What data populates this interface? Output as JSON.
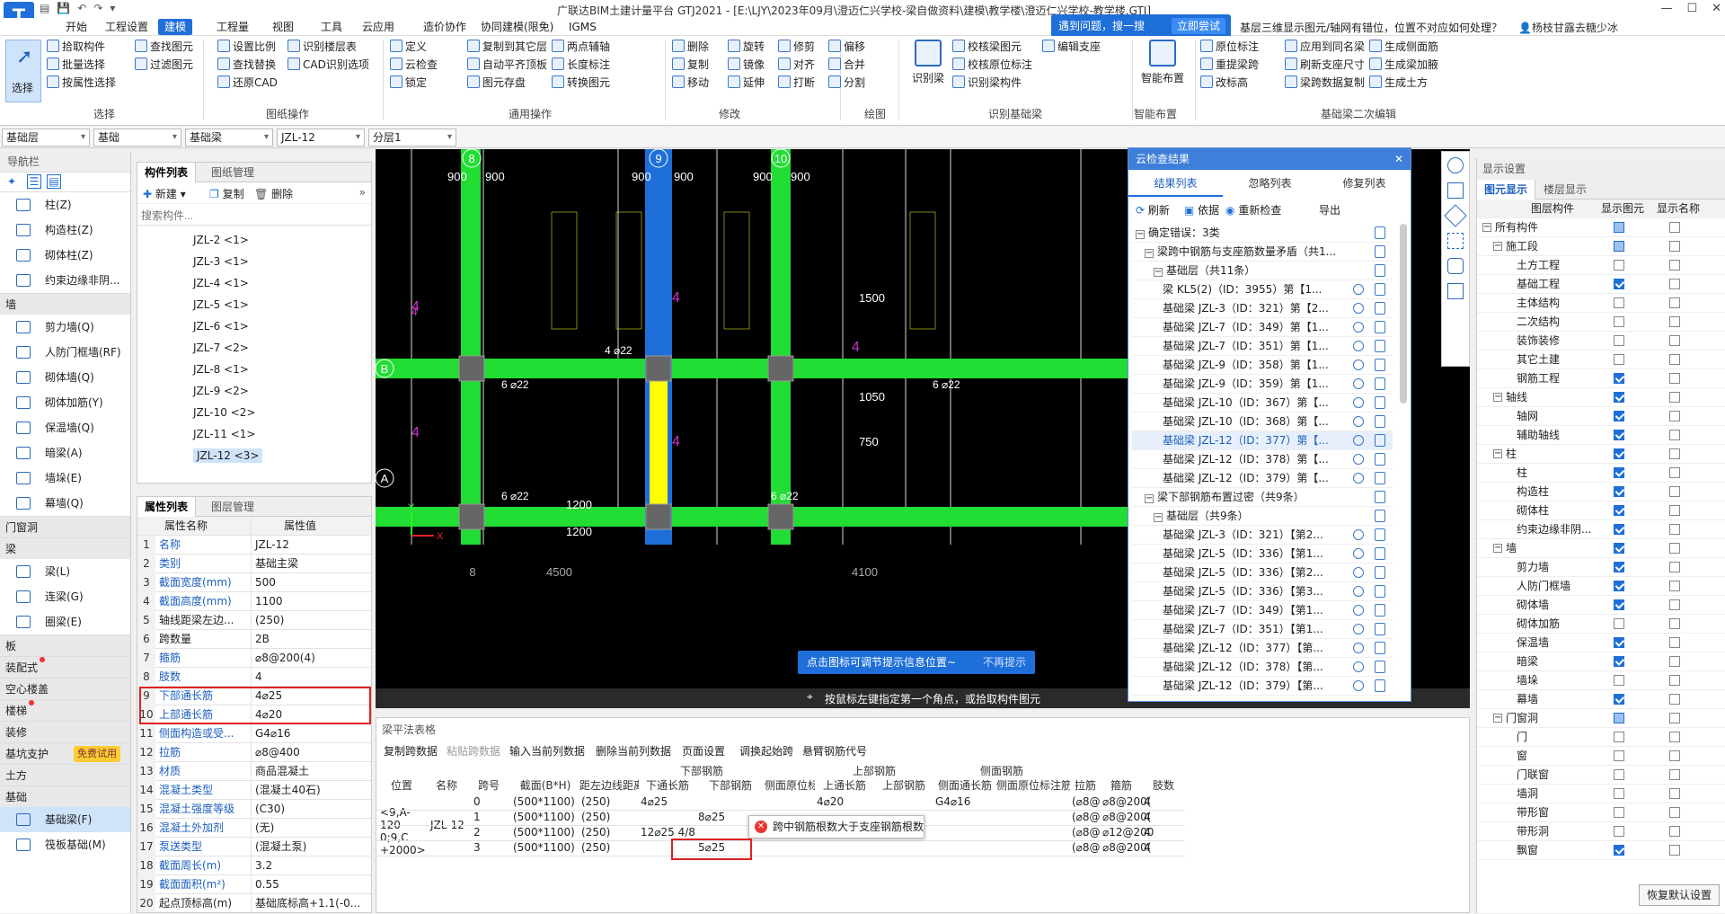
{
  "app": {
    "title": "广联达BIM土建计量平台 GTJ2021 - [E:\\LJY\\2023年09月\\澄迈仁兴学校-梁自做资料\\建模\\教学楼\\澄迈仁兴学校-教学楼.GTJ]",
    "logo": "T",
    "user": "杨枝甘露去糖少冰"
  },
  "menu": [
    "开始",
    "工程设置",
    "建模",
    "工程量",
    "视图",
    "工具",
    "云应用",
    "造价协作",
    "协同建模(限免)",
    "IGMS"
  ],
  "help": {
    "text": "遇到问题，搜一搜",
    "button": "立即尝试",
    "question": "基层三维显示图元/轴网有错位，位置不对应如何处理？"
  },
  "ribbon": {
    "select": {
      "big": "选择",
      "items": [
        "拾取构件",
        "批量选择",
        "按属性选择"
      ],
      "group": "选择"
    },
    "filter": {
      "items": [
        "查找图元",
        "过滤图元"
      ]
    },
    "drawing_ops": {
      "items": [
        "设置比例",
        "识别楼层表",
        "查找替换",
        "CAD识别选项",
        "还原CAD"
      ],
      "group": "图纸操作"
    },
    "common_ops": {
      "items": [
        "定义",
        "复制到其它层",
        "两点辅轴",
        "云检查",
        "自动平齐顶板",
        "长度标注",
        "锁定",
        "图元存盘",
        "转换图元"
      ],
      "group": "通用操作"
    },
    "modify": {
      "items": [
        "删除",
        "旋转",
        "修剪",
        "偏移",
        "复制",
        "镜像",
        "对齐",
        "合并",
        "移动",
        "延伸",
        "打断",
        "分割"
      ],
      "group": "修改"
    },
    "draw": {
      "group": "绘图"
    },
    "recognize": {
      "big": "识别梁",
      "items": [
        "校核梁图元",
        "校核原位标注",
        "识别梁构件",
        "编辑支座"
      ],
      "group": "识别基础梁"
    },
    "smart": {
      "big": "智能布置",
      "group": "智能布置"
    },
    "secondary": {
      "items": [
        "原位标注",
        "应用到同名梁",
        "生成侧面筋",
        "生成吊筋",
        "重提梁跨",
        "刷新支座尺寸",
        "生成梁加腋",
        "生成吊筋",
        "梁跨数据复制",
        "生成土方",
        "改标高"
      ],
      "group": "基础梁二次编辑"
    }
  },
  "filterbar": [
    "基础层",
    "基础",
    "基础梁",
    "JZL-12",
    "分层1"
  ],
  "nav": {
    "header": "导航栏",
    "items": [
      {
        "type": "item",
        "label": "柱(Z)"
      },
      {
        "type": "item",
        "label": "构造柱(Z)"
      },
      {
        "type": "item",
        "label": "砌体柱(Z)"
      },
      {
        "type": "item",
        "label": "约束边缘非阴..."
      },
      {
        "type": "cat",
        "label": "墙"
      },
      {
        "type": "item",
        "label": "剪力墙(Q)"
      },
      {
        "type": "item",
        "label": "人防门框墙(RF)"
      },
      {
        "type": "item",
        "label": "砌体墙(Q)"
      },
      {
        "type": "item",
        "label": "砌体加筋(Y)"
      },
      {
        "type": "item",
        "label": "保温墙(Q)"
      },
      {
        "type": "item",
        "label": "暗梁(A)"
      },
      {
        "type": "item",
        "label": "墙垛(E)"
      },
      {
        "type": "item",
        "label": "幕墙(Q)"
      },
      {
        "type": "cat",
        "label": "门窗洞"
      },
      {
        "type": "cat",
        "label": "梁"
      },
      {
        "type": "item",
        "label": "梁(L)"
      },
      {
        "type": "item",
        "label": "连梁(G)"
      },
      {
        "type": "item",
        "label": "圈梁(E)"
      },
      {
        "type": "cat",
        "label": "板"
      },
      {
        "type": "cat",
        "label": "装配式",
        "dot": true
      },
      {
        "type": "cat",
        "label": "空心楼盖"
      },
      {
        "type": "cat",
        "label": "楼梯",
        "dot": true
      },
      {
        "type": "cat",
        "label": "装修"
      },
      {
        "type": "cat",
        "label": "基坑支护",
        "badge": "免费试用"
      },
      {
        "type": "cat",
        "label": "土方"
      },
      {
        "type": "cat",
        "label": "基础"
      },
      {
        "type": "item",
        "label": "基础梁(F)",
        "active": true
      },
      {
        "type": "item",
        "label": "筏板基础(M)"
      }
    ]
  },
  "complist": {
    "tabs": [
      "构件列表",
      "图纸管理"
    ],
    "toolbar": [
      "新建",
      "复制",
      "删除"
    ],
    "search_placeholder": "搜索构件...",
    "items": [
      "JZL-2 <1>",
      "JZL-3 <1>",
      "JZL-4 <1>",
      "JZL-5 <1>",
      "JZL-6 <1>",
      "JZL-7 <2>",
      "JZL-8 <1>",
      "JZL-9 <2>",
      "JZL-10 <2>",
      "JZL-11 <1>",
      "JZL-12 <3>"
    ],
    "active": "JZL-12 <3>"
  },
  "props": {
    "tabs": [
      "属性列表",
      "图层管理"
    ],
    "headers": [
      "属性名称",
      "属性值"
    ],
    "rows": [
      {
        "n": "1",
        "k": "名称",
        "v": "JZL-12",
        "blue": true
      },
      {
        "n": "2",
        "k": "类别",
        "v": "基础主梁",
        "blue": true
      },
      {
        "n": "3",
        "k": "截面宽度(mm)",
        "v": "500",
        "blue": true
      },
      {
        "n": "4",
        "k": "截面高度(mm)",
        "v": "1100",
        "blue": true
      },
      {
        "n": "5",
        "k": "轴线距梁左边...",
        "v": "(250)",
        "blue": false
      },
      {
        "n": "6",
        "k": "跨数量",
        "v": "2B",
        "blue": false
      },
      {
        "n": "7",
        "k": "箍筋",
        "v": "⌀8@200(4)",
        "blue": true
      },
      {
        "n": "8",
        "k": "肢数",
        "v": "4",
        "blue": true
      },
      {
        "n": "9",
        "k": "下部通长筋",
        "v": "4⌀25",
        "blue": true
      },
      {
        "n": "10",
        "k": "上部通长筋",
        "v": "4⌀20",
        "blue": true
      },
      {
        "n": "11",
        "k": "侧面构造或受...",
        "v": "G4⌀16",
        "blue": true
      },
      {
        "n": "12",
        "k": "拉筋",
        "v": "⌀8@400",
        "blue": true
      },
      {
        "n": "13",
        "k": "材质",
        "v": "商品混凝土",
        "blue": true
      },
      {
        "n": "14",
        "k": "混凝土类型",
        "v": "(混凝土40石)",
        "blue": true
      },
      {
        "n": "15",
        "k": "混凝土强度等级",
        "v": "(C30)",
        "blue": true
      },
      {
        "n": "16",
        "k": "混凝土外加剂",
        "v": "(无)",
        "blue": true
      },
      {
        "n": "17",
        "k": "泵送类型",
        "v": "(混凝土泵)",
        "blue": true
      },
      {
        "n": "18",
        "k": "截面周长(m)",
        "v": "3.2",
        "blue": true
      },
      {
        "n": "19",
        "k": "截面面积(m²)",
        "v": "0.55",
        "blue": true
      },
      {
        "n": "20",
        "k": "起点顶标高(m)",
        "v": "基础底标高+1.1(-0...",
        "blue": false
      }
    ]
  },
  "canvas": {
    "axes_top": [
      "8",
      "9",
      "10"
    ],
    "axes_side": [
      "B",
      "A"
    ],
    "axis_bottom": "8",
    "dims_bottom": [
      "4500",
      "4100"
    ],
    "dims": [
      "900",
      "900",
      "900",
      "900",
      "900",
      "900",
      "1200",
      "1200",
      "1050",
      "750",
      "1500"
    ],
    "labels": [
      "4 ⌀22",
      "6 ⌀22",
      "6 ⌀22",
      "6 ⌀22",
      "6 ⌀22",
      "4"
    ],
    "hint1": "点击图标可调节提示信息位置~",
    "hint1_btn": "不再提示",
    "status": "按鼠标左键指定第一个角点，或拾取构件图元",
    "axis_x": "X",
    "axis_y": "Y"
  },
  "cloud": {
    "title": "云检查结果",
    "tabs": [
      "结果列表",
      "忽略列表",
      "修复列表"
    ],
    "toolbar": [
      "刷新",
      "依据",
      "重新检查",
      "导出"
    ],
    "rows": [
      {
        "indent": 0,
        "text": "确定错误：3类",
        "exp": true
      },
      {
        "indent": 1,
        "text": "梁跨中钢筋与支座筋数量矛盾（共1...",
        "exp": true
      },
      {
        "indent": 2,
        "text": "基础层（共11条）",
        "exp": true
      },
      {
        "indent": 3,
        "text": "梁 KL5(2)（ID：3955）第【1..."
      },
      {
        "indent": 3,
        "text": "基础梁 JZL-3（ID：321）第【2..."
      },
      {
        "indent": 3,
        "text": "基础梁 JZL-7（ID：349）第【1..."
      },
      {
        "indent": 3,
        "text": "基础梁 JZL-7（ID：351）第【1..."
      },
      {
        "indent": 3,
        "text": "基础梁 JZL-9（ID：358）第【1..."
      },
      {
        "indent": 3,
        "text": "基础梁 JZL-9（ID：359）第【1..."
      },
      {
        "indent": 3,
        "text": "基础梁 JZL-10（ID：367）第【..."
      },
      {
        "indent": 3,
        "text": "基础梁 JZL-10（ID：368）第【..."
      },
      {
        "indent": 3,
        "text": "基础梁 JZL-12（ID：377）第【...",
        "sel": true
      },
      {
        "indent": 3,
        "text": "基础梁 JZL-12（ID：378）第【..."
      },
      {
        "indent": 3,
        "text": "基础梁 JZL-12（ID：379）第【..."
      },
      {
        "indent": 1,
        "text": "梁下部钢筋布置过密（共9条）",
        "exp": true
      },
      {
        "indent": 2,
        "text": "基础层（共9条）",
        "exp": true
      },
      {
        "indent": 3,
        "text": "基础梁 JZL-3（ID：321）【第2..."
      },
      {
        "indent": 3,
        "text": "基础梁 JZL-5（ID：336）【第1..."
      },
      {
        "indent": 3,
        "text": "基础梁 JZL-5（ID：336）【第2..."
      },
      {
        "indent": 3,
        "text": "基础梁 JZL-5（ID：336）【第3..."
      },
      {
        "indent": 3,
        "text": "基础梁 JZL-7（ID：349）【第1..."
      },
      {
        "indent": 3,
        "text": "基础梁 JZL-7（ID：351）【第1..."
      },
      {
        "indent": 3,
        "text": "基础梁 JZL-12（ID：377）【第..."
      },
      {
        "indent": 3,
        "text": "基础梁 JZL-12（ID：378）【第..."
      },
      {
        "indent": 3,
        "text": "基础梁 JZL-12（ID：379）【第..."
      }
    ]
  },
  "display": {
    "title": "显示设置",
    "tabs": [
      "图元显示",
      "楼层显示"
    ],
    "headers": [
      "图层构件",
      "显示图元",
      "显示名称"
    ],
    "rows": [
      {
        "l": 0,
        "t": "所有构件",
        "a": "p",
        "b": "off",
        "exp": true
      },
      {
        "l": 1,
        "t": "施工段",
        "a": "p",
        "b": "off",
        "exp": true
      },
      {
        "l": 2,
        "t": "土方工程",
        "a": "off",
        "b": "off"
      },
      {
        "l": 2,
        "t": "基础工程",
        "a": "on",
        "b": "off"
      },
      {
        "l": 2,
        "t": "主体结构",
        "a": "off",
        "b": "off"
      },
      {
        "l": 2,
        "t": "二次结构",
        "a": "off",
        "b": "off"
      },
      {
        "l": 2,
        "t": "装饰装修",
        "a": "off",
        "b": "off"
      },
      {
        "l": 2,
        "t": "其它土建",
        "a": "off",
        "b": "off"
      },
      {
        "l": 2,
        "t": "钢筋工程",
        "a": "on",
        "b": "off"
      },
      {
        "l": 1,
        "t": "轴线",
        "a": "on",
        "b": "off",
        "exp": true
      },
      {
        "l": 2,
        "t": "轴网",
        "a": "on",
        "b": "off"
      },
      {
        "l": 2,
        "t": "辅助轴线",
        "a": "on",
        "b": "off"
      },
      {
        "l": 1,
        "t": "柱",
        "a": "on",
        "b": "off",
        "exp": true
      },
      {
        "l": 2,
        "t": "柱",
        "a": "on",
        "b": "off"
      },
      {
        "l": 2,
        "t": "构造柱",
        "a": "on",
        "b": "off"
      },
      {
        "l": 2,
        "t": "砌体柱",
        "a": "on",
        "b": "off"
      },
      {
        "l": 2,
        "t": "约束边缘非阴...",
        "a": "on",
        "b": "off"
      },
      {
        "l": 1,
        "t": "墙",
        "a": "on",
        "b": "off",
        "exp": true
      },
      {
        "l": 2,
        "t": "剪力墙",
        "a": "on",
        "b": "off"
      },
      {
        "l": 2,
        "t": "人防门框墙",
        "a": "on",
        "b": "off"
      },
      {
        "l": 2,
        "t": "砌体墙",
        "a": "on",
        "b": "off"
      },
      {
        "l": 2,
        "t": "砌体加筋",
        "a": "off",
        "b": "off"
      },
      {
        "l": 2,
        "t": "保温墙",
        "a": "on",
        "b": "off"
      },
      {
        "l": 2,
        "t": "暗梁",
        "a": "on",
        "b": "off"
      },
      {
        "l": 2,
        "t": "墙垛",
        "a": "off",
        "b": "off"
      },
      {
        "l": 2,
        "t": "幕墙",
        "a": "on",
        "b": "off"
      },
      {
        "l": 1,
        "t": "门窗洞",
        "a": "p",
        "b": "off",
        "exp": true
      },
      {
        "l": 2,
        "t": "门",
        "a": "off",
        "b": "off"
      },
      {
        "l": 2,
        "t": "窗",
        "a": "off",
        "b": "off"
      },
      {
        "l": 2,
        "t": "门联窗",
        "a": "off",
        "b": "off"
      },
      {
        "l": 2,
        "t": "墙洞",
        "a": "off",
        "b": "off"
      },
      {
        "l": 2,
        "t": "带形窗",
        "a": "off",
        "b": "off"
      },
      {
        "l": 2,
        "t": "带形洞",
        "a": "off",
        "b": "off"
      },
      {
        "l": 2,
        "t": "飘窗",
        "a": "on",
        "b": "off"
      }
    ],
    "reset": "恢复默认设置"
  },
  "btable": {
    "title": "梁平法表格",
    "toolbar": [
      "复制跨数据",
      "粘贴跨数据",
      "输入当前列数据",
      "删除当前列数据",
      "页面设置",
      "调换起始跨",
      "悬臂钢筋代号"
    ],
    "group_headers": [
      "下部钢筋",
      "上部钢筋",
      "侧面钢筋"
    ],
    "headers": [
      "位置",
      "名称",
      "跨号",
      "截面(B*H)",
      "距左边线距离",
      "下通长筋",
      "下部钢筋",
      "侧面原位标注",
      "上通长筋",
      "上部钢筋",
      "侧面通长筋",
      "侧面原位标注筋",
      "拉筋",
      "箍筋",
      "肢数"
    ],
    "position": "<9,A-120 0;9,C +2000>",
    "name": "JZL-12",
    "rows": [
      {
        "span": "0",
        "sec": "(500*1100)",
        "dist": "(250)",
        "bot": "4⌀25",
        "botx": "",
        "side": "",
        "top": "4⌀20",
        "topx": "",
        "sidel": "G4⌀16",
        "tie": "(⌀8@",
        "stir": "⌀8@200(",
        "legs": "4"
      },
      {
        "span": "1",
        "sec": "(500*1100)",
        "dist": "(250)",
        "bot": "",
        "botx": "8⌀25",
        "side": "",
        "top": "",
        "topx": "",
        "sidel": "",
        "tie": "(⌀8@",
        "stir": "⌀8@200(",
        "legs": "4"
      },
      {
        "span": "2",
        "sec": "(500*1100)",
        "dist": "(250)",
        "bot": "12⌀25 4/8",
        "botx": "",
        "side": "5⌀25",
        "top": "",
        "topx": "6⌀25",
        "sidel": "",
        "tie": "(⌀8@",
        "stir": "⌀12@200",
        "legs": "4"
      },
      {
        "span": "3",
        "sec": "(500*1100)",
        "dist": "(250)",
        "bot": "",
        "botx": "5⌀25",
        "side": "",
        "top": "",
        "topx": "",
        "sidel": "",
        "tie": "(⌀8@",
        "stir": "⌀8@200(",
        "legs": "4"
      }
    ],
    "error_tip": "跨中钢筋根数大于支座钢筋根数",
    "selected_cell": "8⌀25"
  },
  "colors": {
    "beam": "#22dd33",
    "selected_beam": "#ffff00",
    "axis_blue": "#1e6fd9",
    "error_red": "#e02020",
    "annotation_magenta": "#cc33cc"
  }
}
